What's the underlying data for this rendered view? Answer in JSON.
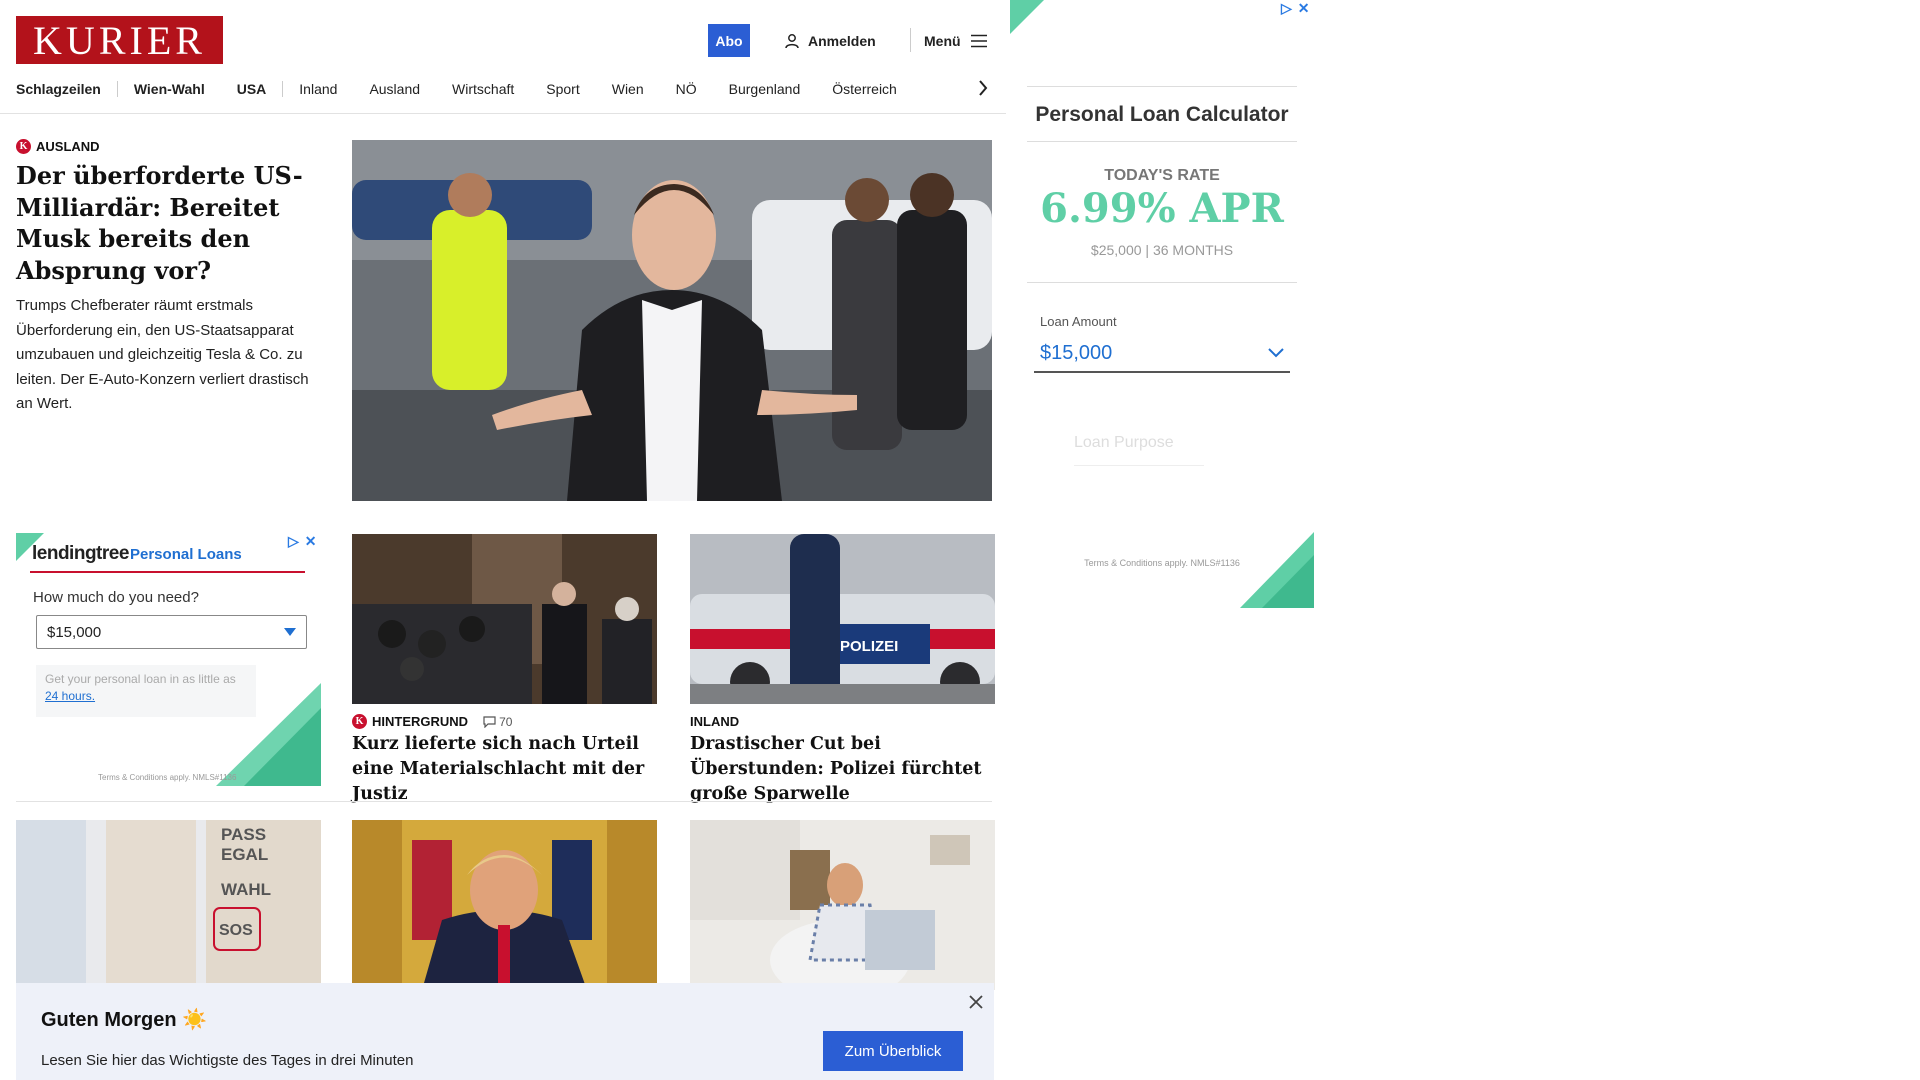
{
  "header": {
    "logo": "KURIER",
    "abo": "Abo",
    "login": "Anmelden",
    "menu": "Menü"
  },
  "nav": [
    "Schlagzeilen",
    "Wien-Wahl",
    "USA",
    "Inland",
    "Ausland",
    "Wirtschaft",
    "Sport",
    "Wien",
    "NÖ",
    "Burgenland",
    "Österreich"
  ],
  "lead": {
    "kicker": "AUSLAND",
    "title": "Der überforderte US-Milliardär: Bereitet Musk bereits den Absprung vor?",
    "teaser": "Trumps Chefberater räumt erstmals Überforderung ein, den US-Staatsapparat umzubauen und gleichzeitig Tesla & Co. zu leiten. Der E-Auto-Konzern verliert drastisch an Wert."
  },
  "ad_left": {
    "brand": "lendingtree",
    "product": "Personal Loans",
    "question": "How much do you need?",
    "amount": "$15,000",
    "promo": "Get your personal loan in as little as",
    "promo_link": "24 hours.",
    "terms": "Terms & Conditions apply. NMLS#1136"
  },
  "ad_right": {
    "title": "Personal Loan Calculator",
    "rate_label": "TODAY'S RATE",
    "rate": "6.99% APR",
    "rate_detail": "$25,000 | 36 MONTHS",
    "amount_label": "Loan Amount",
    "amount": "$15,000",
    "purpose": "Loan Purpose",
    "terms": "Terms & Conditions apply. NMLS#1136"
  },
  "cards": [
    {
      "kicker": "HINTERGRUND",
      "comments": "70",
      "title": "Kurz lieferte sich nach Urteil eine Materialschlacht mit der Justiz"
    },
    {
      "kicker": "INLAND",
      "title": "Drastischer Cut bei Überstunden: Polizei fürchtet große Sparwelle"
    }
  ],
  "toast": {
    "title": "Guten Morgen",
    "text": "Lesen Sie hier das Wichtigste des Tages in drei Minuten",
    "button": "Zum Überblick"
  },
  "colors": {
    "brand_red": "#b3121b",
    "accent_blue": "#2b5ed4",
    "ad_green": "#5fcfa6",
    "ad_blue": "#1f6fd1"
  },
  "icons": {
    "login": "user-icon",
    "menu": "hamburger-icon",
    "nav_next": "chevron-right-icon",
    "comments": "comment-icon",
    "close": "close-icon",
    "weather": "sun-icon"
  }
}
